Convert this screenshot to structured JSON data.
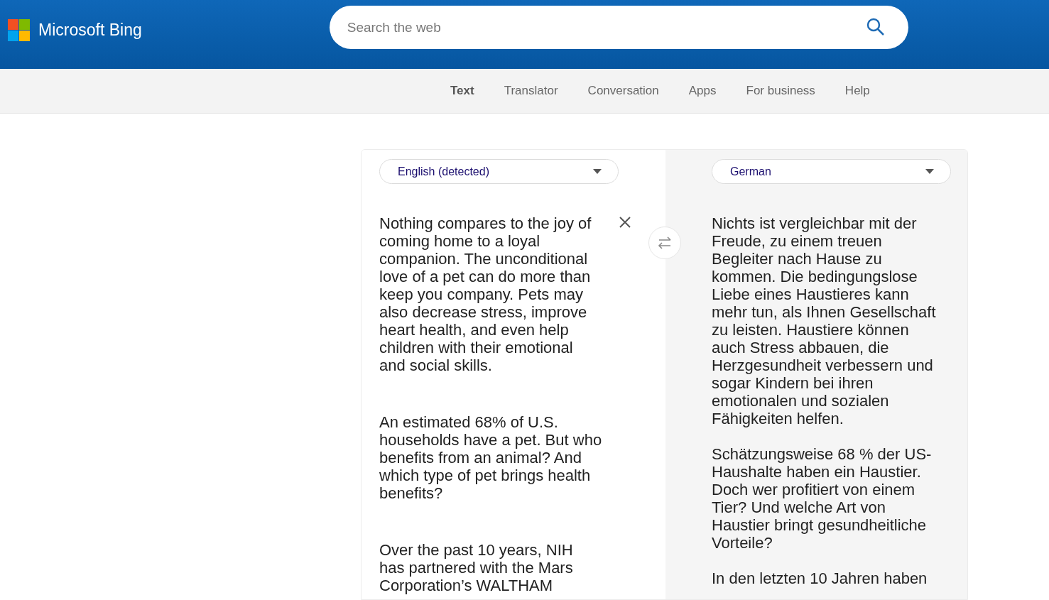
{
  "header": {
    "logo_text": "Microsoft Bing",
    "search": {
      "placeholder": "Search the web"
    }
  },
  "nav": [
    {
      "label": "Text",
      "selected": true
    },
    {
      "label": "Translator",
      "selected": false
    },
    {
      "label": "Conversation",
      "selected": false
    },
    {
      "label": "Apps",
      "selected": false
    },
    {
      "label": "For business",
      "selected": false
    },
    {
      "label": "Help",
      "selected": false
    }
  ],
  "source": {
    "language": "English (detected)",
    "paragraphs": [
      "Nothing compares to the joy of coming home to a loyal companion. The unconditional love of a pet can do more than keep you company. Pets may also decrease stress, improve heart health, and even help children with their emotional and social skills.",
      "An estimated 68% of U.S. households have a pet. But who benefits from an animal? And which type of pet brings health benefits?",
      "Over the past 10 years, NIH has partnered with the Mars Corporation’s WALTHAM"
    ]
  },
  "target": {
    "language": "German",
    "paragraphs": [
      "Nichts ist vergleichbar mit der Freude, zu einem treuen Begleiter nach Hause zu kommen. Die bedingungslose Liebe eines Haustieres kann mehr tun, als Ihnen Gesellschaft zu leisten. Haustiere können auch Stress abbauen, die Herzgesundheit verbessern und sogar Kindern bei ihren emotionalen und sozialen Fähigkeiten helfen.",
      "Schätzungsweise 68 % der US-Haushalte haben ein Haustier. Doch wer profitiert von einem Tier? Und welche Art von Haustier bringt gesundheitliche Vorteile?",
      "In den letzten 10 Jahren haben"
    ]
  }
}
